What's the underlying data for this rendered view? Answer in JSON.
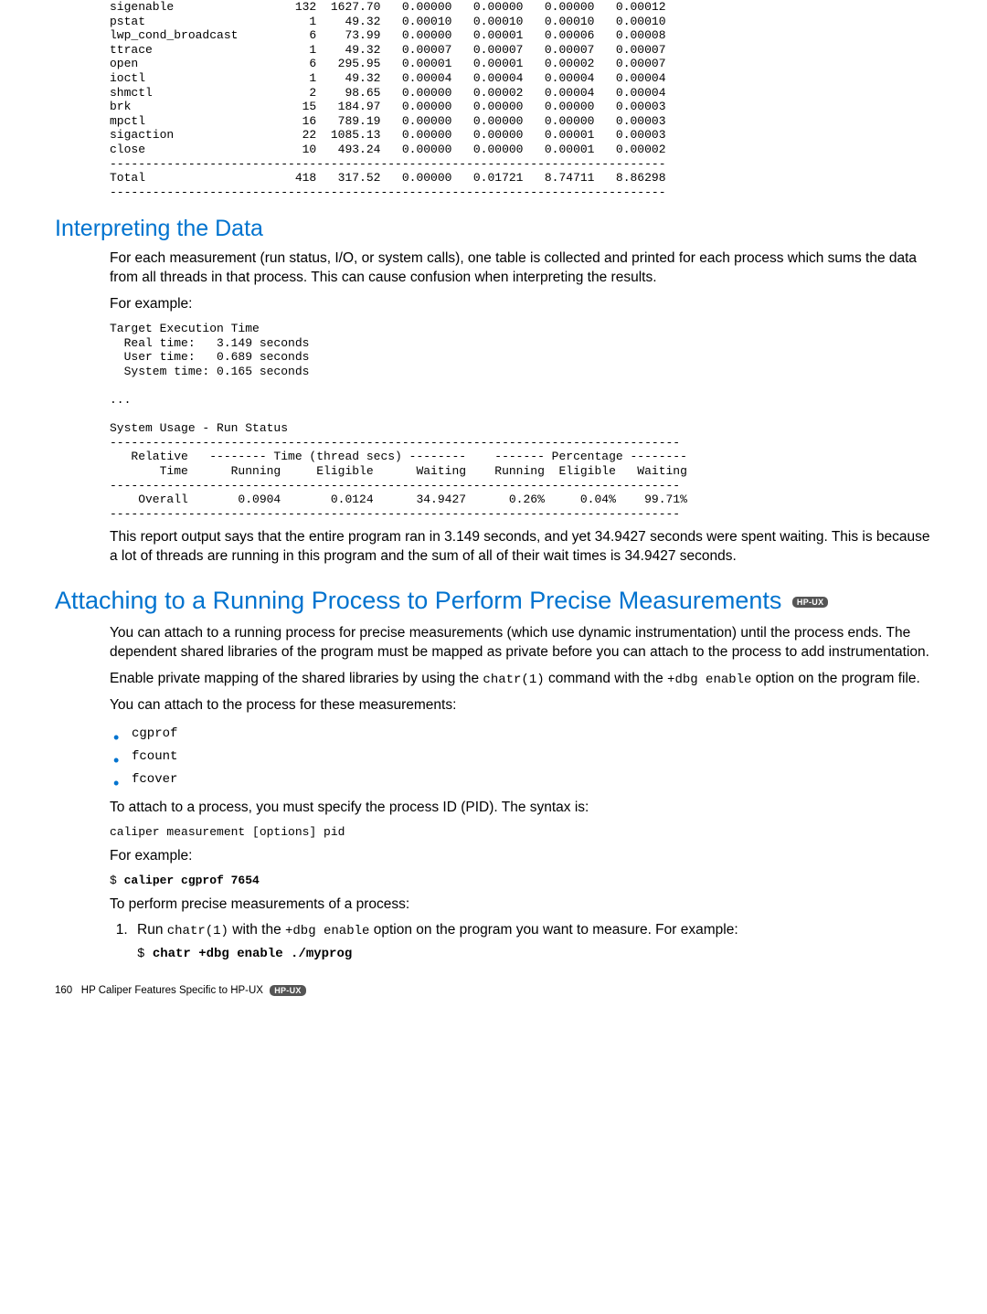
{
  "syscall_table": {
    "rows": [
      {
        "name": "sigenable",
        "count": 132,
        "col1": "1627.70",
        "col2": "0.00000",
        "col3": "0.00000",
        "col4": "0.00000",
        "col5": "0.00012"
      },
      {
        "name": "pstat",
        "count": 1,
        "col1": "49.32",
        "col2": "0.00010",
        "col3": "0.00010",
        "col4": "0.00010",
        "col5": "0.00010"
      },
      {
        "name": "lwp_cond_broadcast",
        "count": 6,
        "col1": "73.99",
        "col2": "0.00000",
        "col3": "0.00001",
        "col4": "0.00006",
        "col5": "0.00008"
      },
      {
        "name": "ttrace",
        "count": 1,
        "col1": "49.32",
        "col2": "0.00007",
        "col3": "0.00007",
        "col4": "0.00007",
        "col5": "0.00007"
      },
      {
        "name": "open",
        "count": 6,
        "col1": "295.95",
        "col2": "0.00001",
        "col3": "0.00001",
        "col4": "0.00002",
        "col5": "0.00007"
      },
      {
        "name": "ioctl",
        "count": 1,
        "col1": "49.32",
        "col2": "0.00004",
        "col3": "0.00004",
        "col4": "0.00004",
        "col5": "0.00004"
      },
      {
        "name": "shmctl",
        "count": 2,
        "col1": "98.65",
        "col2": "0.00000",
        "col3": "0.00002",
        "col4": "0.00004",
        "col5": "0.00004"
      },
      {
        "name": "brk",
        "count": 15,
        "col1": "184.97",
        "col2": "0.00000",
        "col3": "0.00000",
        "col4": "0.00000",
        "col5": "0.00003"
      },
      {
        "name": "mpctl",
        "count": 16,
        "col1": "789.19",
        "col2": "0.00000",
        "col3": "0.00000",
        "col4": "0.00000",
        "col5": "0.00003"
      },
      {
        "name": "sigaction",
        "count": 22,
        "col1": "1085.13",
        "col2": "0.00000",
        "col3": "0.00000",
        "col4": "0.00001",
        "col5": "0.00003"
      },
      {
        "name": "close",
        "count": 10,
        "col1": "493.24",
        "col2": "0.00000",
        "col3": "0.00000",
        "col4": "0.00001",
        "col5": "0.00002"
      }
    ],
    "total": {
      "name": "Total",
      "count": 418,
      "col1": "317.52",
      "col2": "0.00000",
      "col3": "0.01721",
      "col4": "8.74711",
      "col5": "8.86298"
    }
  },
  "interpreting": {
    "heading": "Interpreting the Data",
    "para1": "For each measurement (run status, I/O, or system calls), one table is collected and printed for each process which sums the data from all threads in that process. This can cause confusion when interpreting the results.",
    "for_example_label": "For example:",
    "code_block": "Target Execution Time\n  Real time:   3.149 seconds\n  User time:   0.689 seconds\n  System time: 0.165 seconds\n\n...\n\nSystem Usage - Run Status\n--------------------------------------------------------------------------------\n   Relative   -------- Time (thread secs) --------    ------- Percentage --------\n       Time      Running     Eligible      Waiting    Running  Eligible   Waiting\n--------------------------------------------------------------------------------\n    Overall       0.0904       0.0124      34.9427      0.26%     0.04%    99.71%\n--------------------------------------------------------------------------------",
    "para2": "This report output says that the entire program ran in 3.149 seconds, and yet 34.9427 seconds were spent waiting. This is because a lot of threads are running in this program and the sum of all of their wait times is 34.9427 seconds."
  },
  "attaching": {
    "heading": "Attaching to a Running Process to Perform Precise Measurements",
    "badge": "HP-UX",
    "para1": "You can attach to a running process for precise measurements (which use dynamic instrumentation) until the process ends. The dependent shared libraries of the program must be mapped as private before you can attach to the process to add instrumentation.",
    "para2_a": "Enable private mapping of the shared libraries by using the ",
    "para2_code1": "chatr(1)",
    "para2_b": " command with the ",
    "para2_code2": "+dbg enable",
    "para2_c": " option on the program file.",
    "para3": "You can attach to the process for these measurements:",
    "bullets": [
      "cgprof",
      "fcount",
      "fcover"
    ],
    "para4": "To attach to a process, you must specify the process ID (PID). The syntax is:",
    "syntax": "caliper measurement [options] pid",
    "for_example_label": "For example:",
    "example_prompt": "$ ",
    "example_cmd": "caliper cgprof 7654",
    "para5": "To perform precise measurements of a process:",
    "step1_a": "Run ",
    "step1_code1": "chatr(1)",
    "step1_b": " with the ",
    "step1_code2": "+dbg enable",
    "step1_c": " option on the program you want to measure. For example:",
    "step1_cmd_prompt": "$ ",
    "step1_cmd": "chatr +dbg enable ./myprog"
  },
  "footer": {
    "page": "160",
    "text": "HP Caliper Features Specific to HP-UX",
    "badge": "HP-UX"
  }
}
